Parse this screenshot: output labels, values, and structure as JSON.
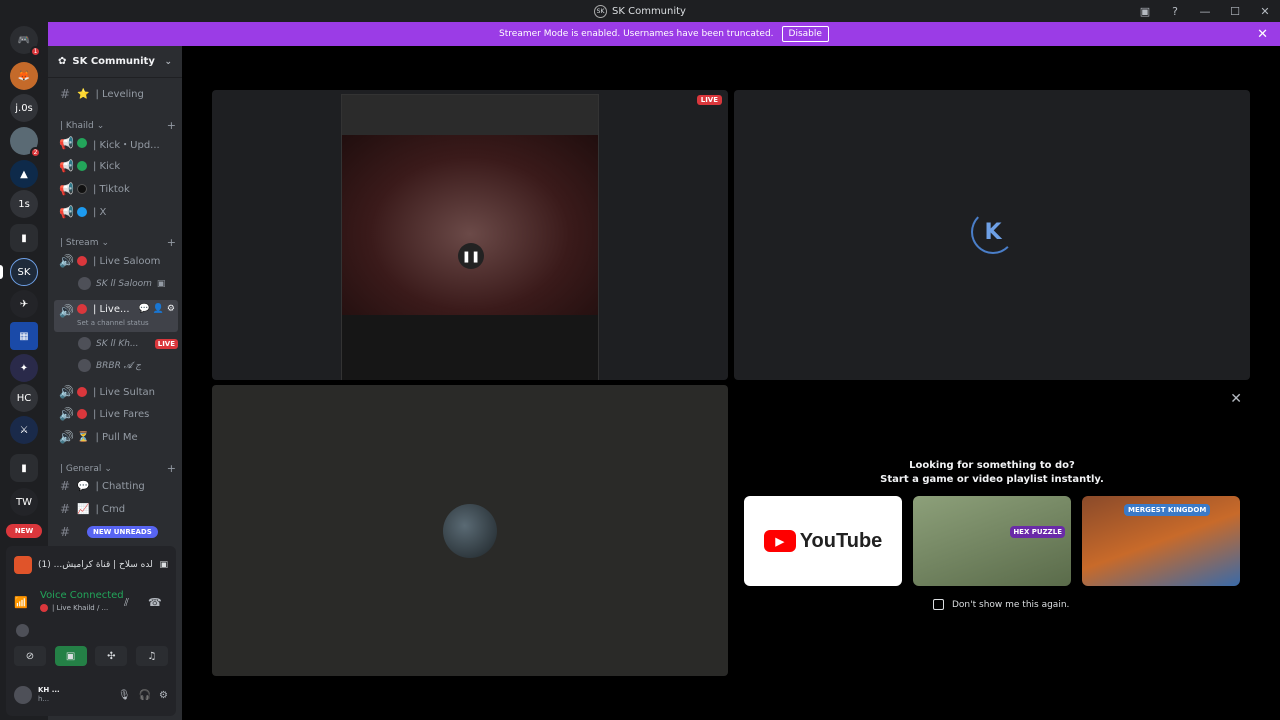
{
  "window": {
    "title": "SK Community"
  },
  "banner": {
    "text": "Streamer Mode is enabled. Usernames have been truncated.",
    "disable_label": "Disable"
  },
  "guilds": {
    "home_badge": "1",
    "items": [
      {
        "label": "j.0s"
      },
      {
        "label": "1s"
      },
      {
        "label": "HC"
      }
    ],
    "dm_badge": "2",
    "new_label": "NEW"
  },
  "server": {
    "name": "SK Community",
    "channels": [
      {
        "name": "| Leveling"
      }
    ],
    "categories": [
      {
        "name": "| Khaild",
        "channels": [
          {
            "name": "| Kick・Upd..."
          },
          {
            "name": "| Kick"
          },
          {
            "name": "| Tiktok"
          },
          {
            "name": "| X"
          }
        ]
      },
      {
        "name": "| Stream",
        "channels": [
          {
            "name": "| Live Saloom",
            "members": [
              {
                "name": "SK ll Saloom"
              }
            ]
          },
          {
            "name": "| Live...",
            "status": "Set a channel status",
            "members": [
              {
                "name": "SK ll Kh...",
                "live": "LIVE"
              },
              {
                "name": "BRBR 𝓐 ج"
              }
            ]
          },
          {
            "name": "| Live Sultan"
          },
          {
            "name": "| Live Fares"
          },
          {
            "name": "| Pull Me"
          }
        ]
      },
      {
        "name": "| General",
        "channels": [
          {
            "name": "| Chatting"
          },
          {
            "name": "| Cmd"
          }
        ]
      }
    ],
    "unreads_label": "NEW UNREADS"
  },
  "voice": {
    "media_title": "(1) ...لده سلاح | قناة كراميش",
    "connected_label": "Voice Connected",
    "channel_path": "| Live Khaild / ...",
    "user": {
      "name": "KH ...",
      "status": "h..."
    }
  },
  "stage": {
    "live_label": "LIVE"
  },
  "activity": {
    "title_line1": "Looking for something to do?",
    "title_line2": "Start a game or video playlist instantly.",
    "youtube_label": "YouTube",
    "hex_label": "HEX PUZZLE",
    "merge_label": "MERGEST KINGDOM",
    "dont_show_label": "Don't show me this again."
  },
  "colors": {
    "accent": "#9b3ce6",
    "live": "#da373c",
    "online": "#23a55a"
  }
}
